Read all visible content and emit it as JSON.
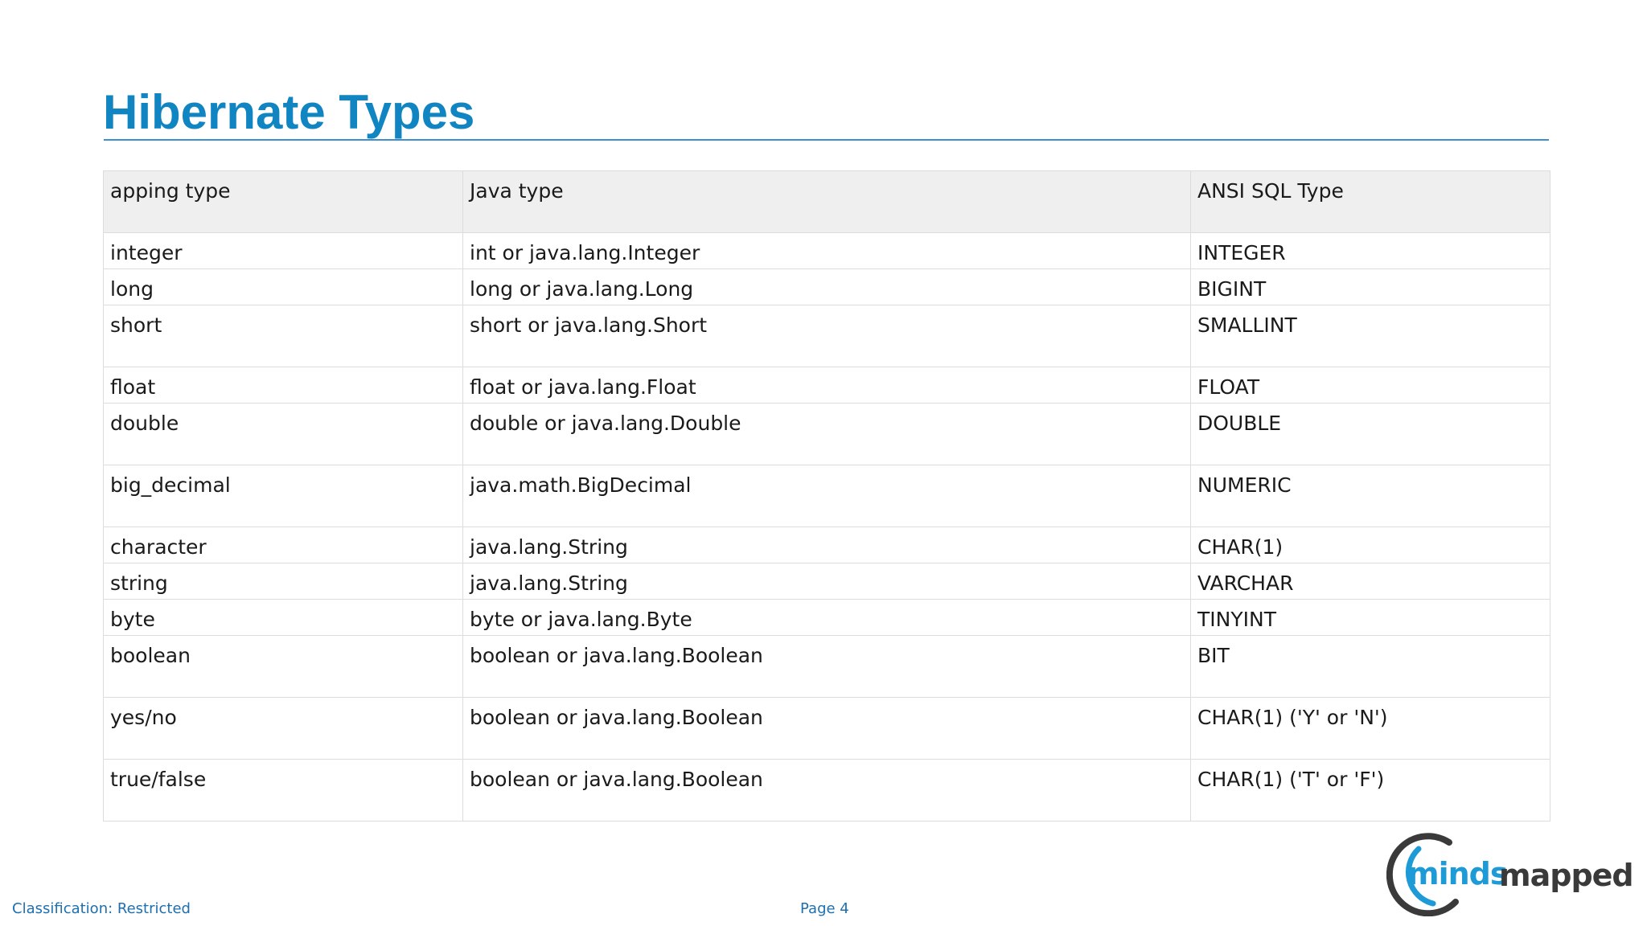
{
  "slide": {
    "title": "Hibernate Types",
    "title_color": "#1185c2"
  },
  "table": {
    "headers": [
      "apping type",
      "Java type",
      "ANSI SQL Type"
    ],
    "rows": [
      [
        "integer",
        "int or java.lang.Integer",
        "INTEGER"
      ],
      [
        "long",
        "long or java.lang.Long",
        "BIGINT"
      ],
      [
        "short",
        "short or java.lang.Short",
        "SMALLINT"
      ],
      [
        "float",
        "float or java.lang.Float",
        "FLOAT"
      ],
      [
        "double",
        "double or java.lang.Double",
        "DOUBLE"
      ],
      [
        "big_decimal",
        "java.math.BigDecimal",
        "NUMERIC"
      ],
      [
        "character",
        "java.lang.String",
        "CHAR(1)"
      ],
      [
        "string",
        "java.lang.String",
        "VARCHAR"
      ],
      [
        "byte",
        "byte or java.lang.Byte",
        "TINYINT"
      ],
      [
        "boolean",
        "boolean or java.lang.Boolean",
        "BIT"
      ],
      [
        "yes/no",
        "boolean or java.lang.Boolean",
        "CHAR(1) ('Y' or 'N')"
      ],
      [
        "true/false",
        "boolean or java.lang.Boolean",
        "CHAR(1) ('T' or 'F')"
      ]
    ]
  },
  "footer": {
    "classification": "Classification: Restricted",
    "page": "Page 4"
  },
  "logo": {
    "text": "mindsmapped",
    "icon": "mindsmapped-logo",
    "blue": "#1e9bd7",
    "dark": "#3a3a3a"
  }
}
